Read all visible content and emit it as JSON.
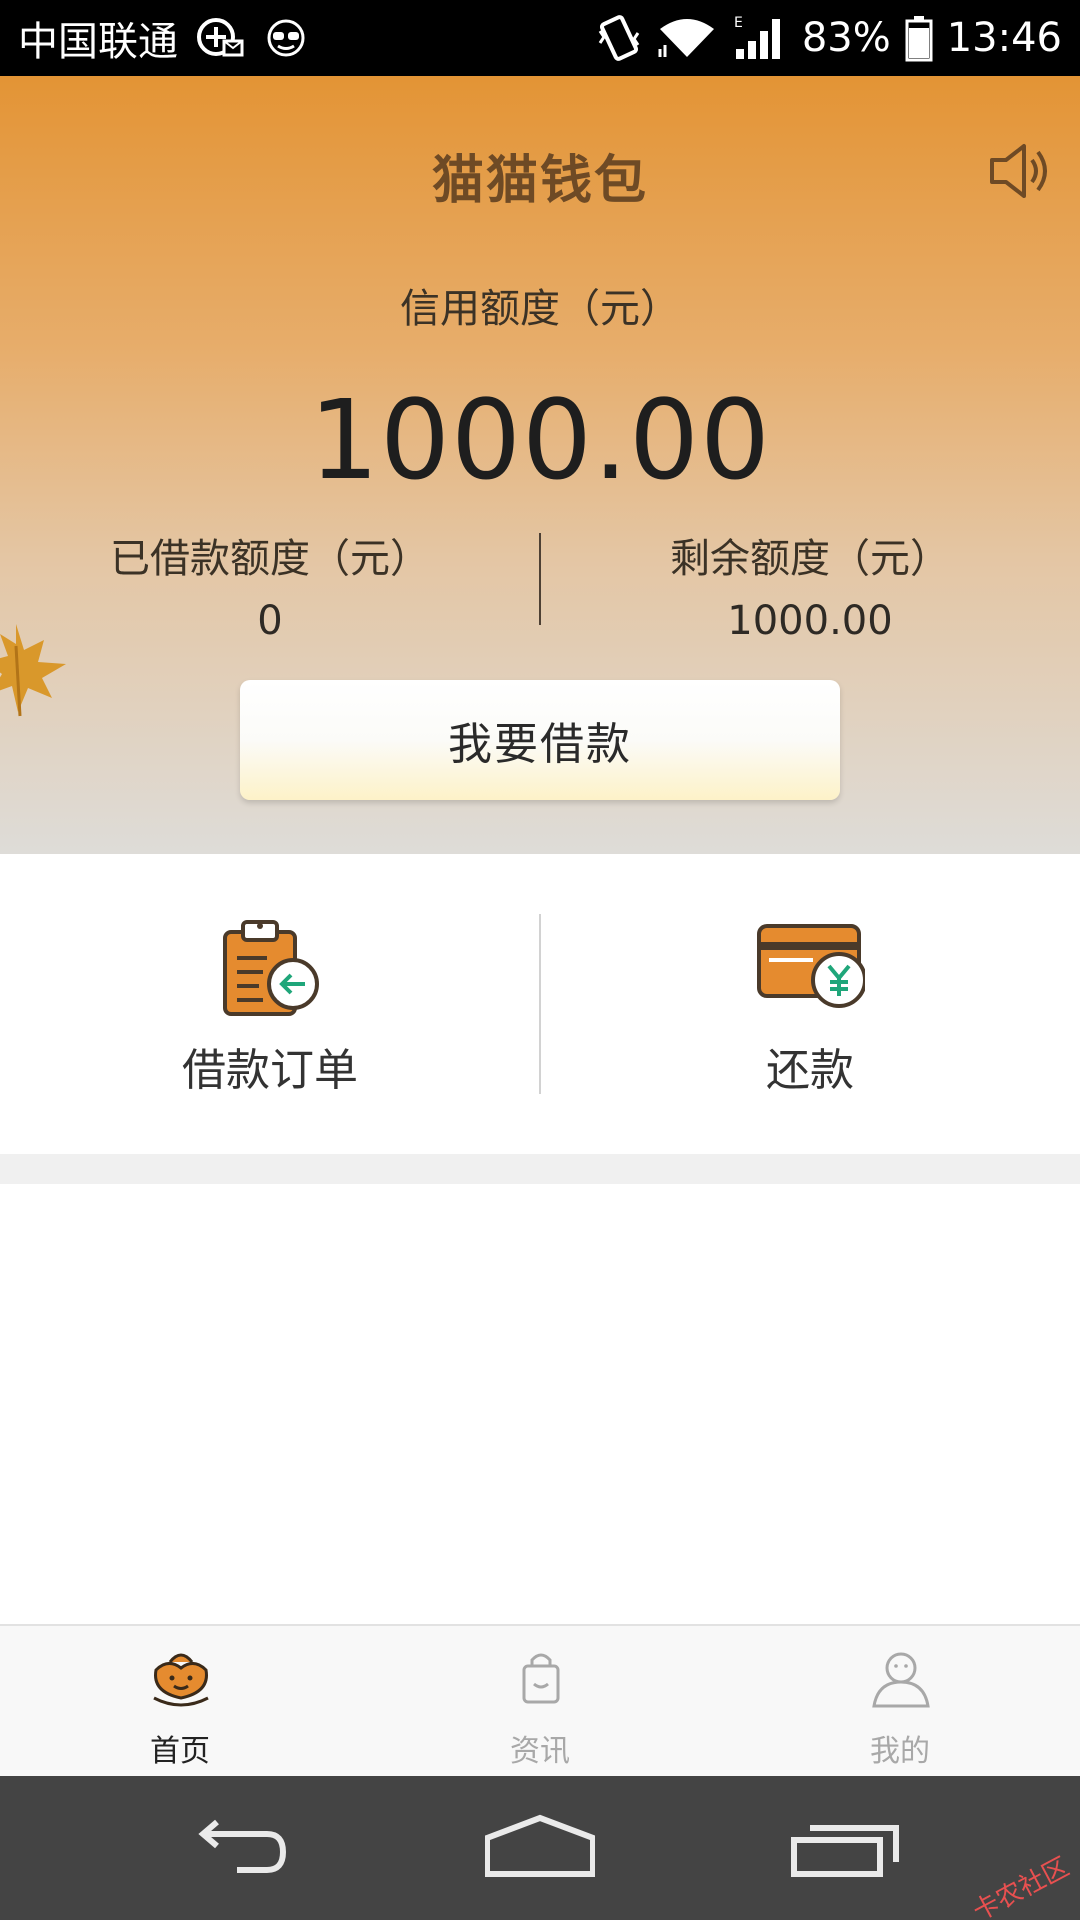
{
  "status_bar": {
    "carrier": "中国联通",
    "battery_percent": "83%",
    "time": "13:46",
    "network_type": "E",
    "icons": [
      "hd-call-icon",
      "message-icon",
      "glasses-icon",
      "vibrate-icon",
      "wifi-icon",
      "signal-icon",
      "battery-icon"
    ]
  },
  "header": {
    "title": "猫猫钱包",
    "speaker_icon": "speaker-icon"
  },
  "credit": {
    "label": "信用额度（元）",
    "value": "1000.00"
  },
  "borrowed": {
    "label": "已借款额度（元）",
    "value": "0"
  },
  "remaining": {
    "label": "剩余额度（元）",
    "value": "1000.00"
  },
  "borrow_button": {
    "label": "我要借款"
  },
  "actions": [
    {
      "label": "借款订单",
      "icon": "clipboard-order-icon"
    },
    {
      "label": "还款",
      "icon": "card-repay-icon"
    }
  ],
  "tabs": [
    {
      "label": "首页",
      "icon": "home-flower-icon",
      "active": true
    },
    {
      "label": "资讯",
      "icon": "bag-icon",
      "active": false
    },
    {
      "label": "我的",
      "icon": "person-icon",
      "active": false
    }
  ],
  "system_nav": {
    "icons": [
      "back-icon",
      "home-icon",
      "recents-icon"
    ]
  },
  "watermark": {
    "text": "卡农社区"
  },
  "colors": {
    "accent_orange": "#e58b2f",
    "title_brown": "#6e4a25",
    "repay_green": "#1fa67a"
  }
}
